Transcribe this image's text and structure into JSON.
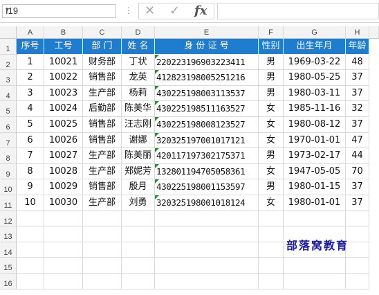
{
  "formula_bar": {
    "name_box": "I19",
    "fx_label": "fx",
    "formula_value": ""
  },
  "columns": [
    "A",
    "B",
    "C",
    "D",
    "E",
    "F",
    "G",
    "H"
  ],
  "rows": [
    "1",
    "2",
    "3",
    "4",
    "5",
    "6",
    "7",
    "8",
    "9",
    "10",
    "11",
    "12",
    "13",
    "14",
    "15",
    "16"
  ],
  "table": {
    "headers": [
      "序号",
      "工号",
      "部 门",
      "姓 名",
      "身 份 证 号",
      "性别",
      "出生年月",
      "年龄"
    ],
    "records": [
      [
        "1",
        "10021",
        "财务部",
        "丁状",
        "220223196903223411",
        "男",
        "1969-03-22",
        "48"
      ],
      [
        "2",
        "10022",
        "销售部",
        "龙英",
        "412823198005251216",
        "男",
        "1980-05-25",
        "37"
      ],
      [
        "3",
        "10023",
        "生产部",
        "杨莉",
        "430225198003113537",
        "男",
        "1980-03-11",
        "37"
      ],
      [
        "4",
        "10024",
        "后勤部",
        "陈美华",
        "430225198511163527",
        "女",
        "1985-11-16",
        "32"
      ],
      [
        "5",
        "10025",
        "销售部",
        "汪志刚",
        "430225198008123527",
        "女",
        "1980-08-12",
        "37"
      ],
      [
        "6",
        "10026",
        "销售部",
        "谢娜",
        "320325197001017121",
        "女",
        "1970-01-01",
        "47"
      ],
      [
        "7",
        "10027",
        "生产部",
        "陈美丽",
        "420117197302175371",
        "男",
        "1973-02-17",
        "44"
      ],
      [
        "8",
        "10028",
        "生产部",
        "郑妮芳",
        "132801194705058361",
        "女",
        "1947-05-05",
        "70"
      ],
      [
        "9",
        "10029",
        "销售部",
        "殷月",
        "430225198001153597",
        "男",
        "1980-01-15",
        "37"
      ],
      [
        "10",
        "10030",
        "生产部",
        "刘勇",
        "320325198001018124",
        "女",
        "1980-01-01",
        "37"
      ]
    ]
  },
  "watermark": "部落窝教育",
  "colors": {
    "header_fill": "#1f7dd0",
    "header_text": "#ffffff",
    "error_flag": "#2e8b3a"
  }
}
